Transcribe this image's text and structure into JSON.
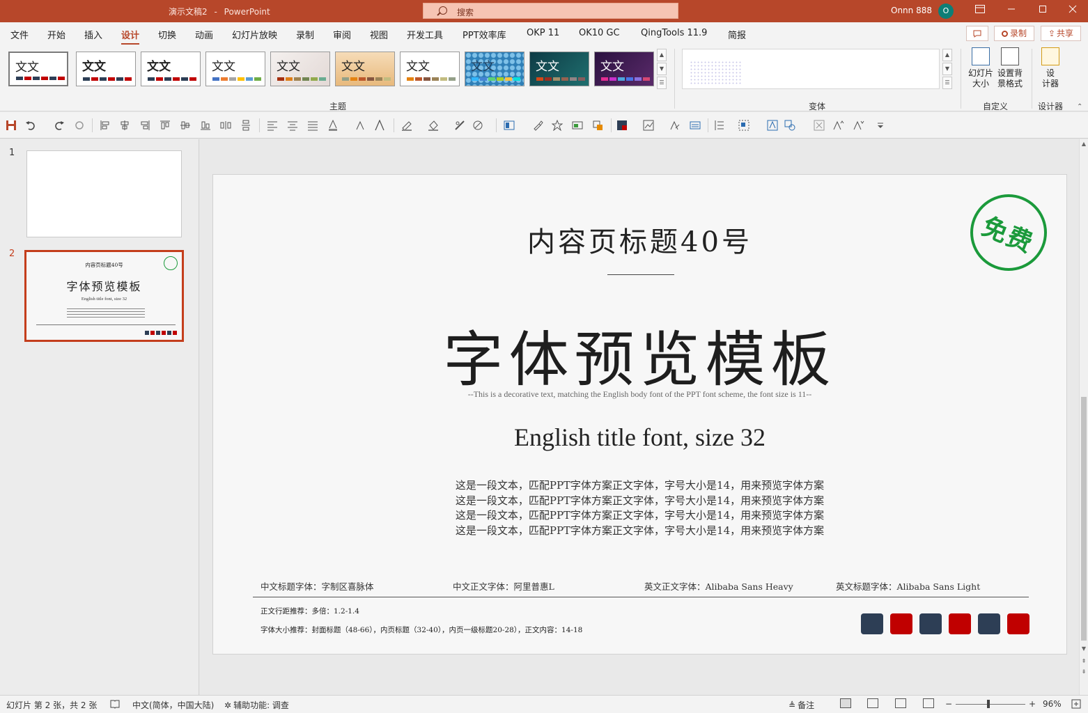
{
  "window": {
    "doc_title": "演示文稿2",
    "app_name": "PowerPoint",
    "search_placeholder": "搜索",
    "user_name": "Onnn 888",
    "avatar_initial": "O"
  },
  "tabs": [
    "文件",
    "开始",
    "插入",
    "设计",
    "切换",
    "动画",
    "幻灯片放映",
    "录制",
    "审阅",
    "视图",
    "开发工具",
    "PPT效率库",
    "OKP 11",
    "OK10 GC",
    "QingTools 11.9",
    "简报"
  ],
  "active_tab": "设计",
  "ribbon_actions": {
    "record": "录制",
    "share": "共享"
  },
  "ribbon": {
    "theme_label": "文文",
    "groups": {
      "themes": "主题",
      "variants": "变体",
      "customize": "自定义",
      "designer": "设计器"
    },
    "slide_size": "幻灯片\n大小",
    "format_bg": "设置背\n景格式",
    "designer_btn": "设\n计器"
  },
  "slides_panel": {
    "slide1_num": "1",
    "slide2_num": "2"
  },
  "thumb2": {
    "head": "内容页标题40号",
    "big": "字体预览模板",
    "eng": "English title font, size 32"
  },
  "slide": {
    "heading": "内容页标题40号",
    "big_title": "字体预览模板",
    "decorative": "--This is a decorative text, matching the English body font of the PPT font scheme, the font size is 11--",
    "english_title": "English title font, size 32",
    "body_lines": [
      "这是一段文本，匹配PPT字体方案正文字体，字号大小是14，用来预览字体方案",
      "这是一段文本，匹配PPT字体方案正文字体，字号大小是14，用来预览字体方案",
      "这是一段文本，匹配PPT字体方案正文字体，字号大小是14，用来预览字体方案",
      "这是一段文本，匹配PPT字体方案正文字体，字号大小是14，用来预览字体方案"
    ],
    "font_info": [
      "中文标题字体：字制区喜脉体",
      "中文正文字体：阿里普惠L",
      "英文正文字体：Alibaba Sans Heavy",
      "英文标题字体：Alibaba Sans Light"
    ],
    "note_line_spacing": "正文行距推荐：多倍：1.2-1.4",
    "note_font_size": "字体大小推荐：封面标题（48-66），内页标题（32-40），内页一级标题20-28），正文内容：14-18",
    "stamp": "免费",
    "chip_colors": [
      "#2d3e55",
      "#c00000",
      "#2d3e55",
      "#c00000",
      "#2d3e55",
      "#c00000"
    ]
  },
  "status": {
    "slide_info": "幻灯片 第 2 张，共 2 张",
    "language": "中文(简体，中国大陆)",
    "accessibility": "辅助功能: 调查",
    "notes": "备注",
    "zoom": "96%"
  },
  "colors": {
    "accent": "#b7472a",
    "stamp_green": "#1b9a3b"
  }
}
